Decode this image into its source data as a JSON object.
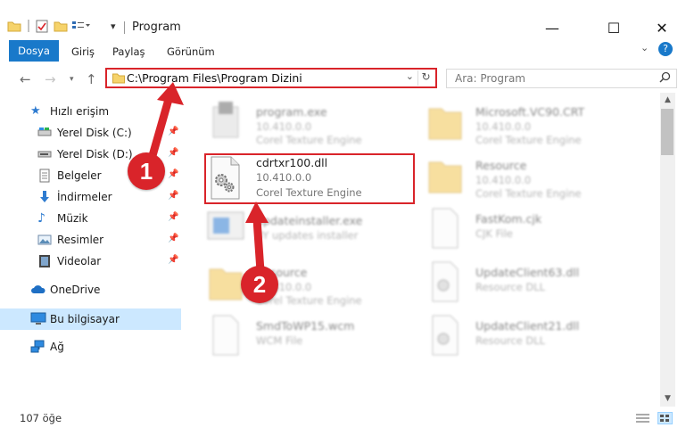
{
  "window": {
    "title": "Program",
    "controls": {
      "minimize": "—",
      "maximize": "☐",
      "close": "✕"
    }
  },
  "ribbon": {
    "tabs": [
      {
        "label": "Dosya",
        "active": true
      },
      {
        "label": "Giriş"
      },
      {
        "label": "Paylaş"
      },
      {
        "label": "Görünüm"
      }
    ],
    "help": "?"
  },
  "address": {
    "path": "C:\\Program Files\\Program Dizini",
    "search_placeholder": "Ara: Program"
  },
  "sidebar": {
    "items": [
      {
        "label": "Hızlı erişim",
        "icon": "star-icon",
        "pinned": false
      },
      {
        "label": "Yerel Disk (C:)",
        "icon": "drive-icon",
        "pinned": true
      },
      {
        "label": "Yerel Disk (D:)",
        "icon": "drive-icon",
        "pinned": true
      },
      {
        "label": "Belgeler",
        "icon": "documents-icon",
        "pinned": true
      },
      {
        "label": "İndirmeler",
        "icon": "download-icon",
        "pinned": true
      },
      {
        "label": "Müzik",
        "icon": "music-icon",
        "pinned": true
      },
      {
        "label": "Resimler",
        "icon": "pictures-icon",
        "pinned": true
      },
      {
        "label": "Videolar",
        "icon": "video-icon",
        "pinned": true
      },
      {
        "label": "OneDrive",
        "icon": "cloud-icon",
        "pinned": false
      },
      {
        "label": "Bu bilgisayar",
        "icon": "computer-icon",
        "pinned": false,
        "selected": true
      },
      {
        "label": "Ağ",
        "icon": "network-icon",
        "pinned": false
      }
    ]
  },
  "files": {
    "left": [
      {
        "name": "program.exe",
        "version": "10.410.0.0",
        "desc": "Corel Texture Engine",
        "icon": "exe-icon",
        "blurred": true
      },
      {
        "name": "cdrtxr100.dll",
        "version": "10.410.0.0",
        "desc": "Corel Texture Engine",
        "icon": "dll-gear-icon",
        "blurred": false
      },
      {
        "name": "updateinstaller.exe",
        "version": "",
        "desc": "BY updates installer",
        "icon": "installer-icon",
        "blurred": true
      },
      {
        "name": "Resource",
        "version": "10.410.0.0",
        "desc": "Corel Texture Engine",
        "icon": "folder-icon",
        "blurred": true
      },
      {
        "name": "SmdToWP15.wcm",
        "version": "",
        "desc": "WCM File",
        "icon": "file-icon",
        "blurred": true
      }
    ],
    "right": [
      {
        "name": "Microsoft.VC90.CRT",
        "version": "10.410.0.0",
        "desc": "Corel Texture Engine",
        "icon": "folder-icon",
        "blurred": true
      },
      {
        "name": "Resource",
        "version": "10.410.0.0",
        "desc": "Corel Texture Engine",
        "icon": "folder-icon",
        "blurred": true
      },
      {
        "name": "FastKom.cjk",
        "version": "",
        "desc": "CJK File",
        "icon": "file-icon",
        "blurred": true
      },
      {
        "name": "UpdateClient63.dll",
        "version": "",
        "desc": "Resource DLL",
        "icon": "dll-gear-icon",
        "blurred": true
      },
      {
        "name": "UpdateClient21.dll",
        "version": "",
        "desc": "Resource DLL",
        "icon": "dll-gear-icon",
        "blurred": true
      }
    ]
  },
  "status": {
    "count": "107 öğe"
  },
  "annotations": {
    "step1": "1",
    "step2": "2",
    "color": "#d9242a"
  }
}
